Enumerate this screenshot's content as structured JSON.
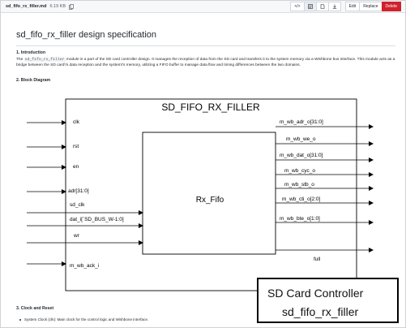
{
  "toolbar": {
    "filename": "sd_fifo_rx_filler.md",
    "filesize": "6.19 KB",
    "buttons": [
      "</>",
      "",
      "",
      "",
      "Edit",
      "Replace",
      "Delete"
    ]
  },
  "doc": {
    "title": "sd_fifo_rx_filler design specification",
    "sections": {
      "intro_heading": "1. Introduction",
      "intro_pre": "The ",
      "intro_code": "sd_fifo_rx_filler",
      "intro_post": " module is a part of the SD card controller design. It manages the reception of data from the SD card and transfers it to the system memory via a Wishbone bus interface. This module acts as a bridge between the SD card\\'s data reception and the system\\'s memory, utilizing a FIFO buffer to manage data flow and timing differences between the two domains.",
      "block_heading": "2. Block Diagram",
      "clock_heading": "3. Clock and Reset",
      "clock_item": "System Clock (clk): Main clock for the control logic and Wishbone interface."
    }
  },
  "diagram": {
    "outer_title": "SD_FIFO_RX_FILLER",
    "inner_title": "Rx_Fifo",
    "inputs": [
      "clk",
      "rst",
      "en",
      "adr[31:0]",
      "sd_clk",
      "dat_i[`SD_BUS_W-1:0]",
      "wr",
      "m_wb_ack_i"
    ],
    "outputs": [
      "m_wb_adr_o[31:0]",
      "m_wb_we_o",
      "m_wb_dat_o[31:0]",
      "m_wb_cyc_o",
      "m_wb_stb_o",
      "m_wb_cti_o[2:0]",
      "m_wb_bte_o[1:0]",
      "full"
    ]
  },
  "overlay": {
    "line1": "SD Card Controller",
    "line2": "sd_fifo_rx_filler"
  }
}
